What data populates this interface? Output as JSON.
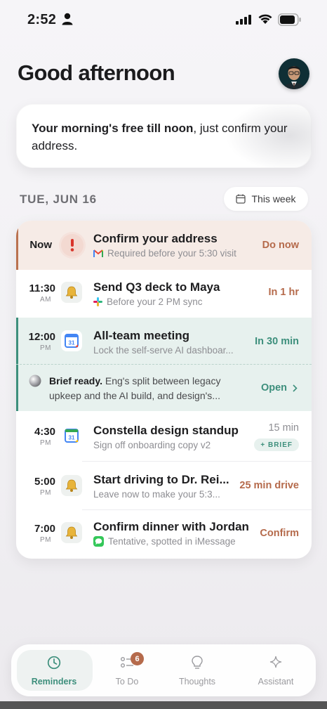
{
  "status_bar": {
    "time": "2:52"
  },
  "header": {
    "greeting": "Good afternoon"
  },
  "summary": {
    "bold": "Your morning's free till noon",
    "rest": ", just confirm your address."
  },
  "day": {
    "label": "TUE, JUN 16",
    "week_button": "This week"
  },
  "items": [
    {
      "time": "Now",
      "ampm": "",
      "title": "Confirm your address",
      "sub": "Required before your 5:30 visit",
      "action": "Do now",
      "icon": "exclamation-icon",
      "sub_icon": "gmail-icon"
    },
    {
      "time": "11:30",
      "ampm": "AM",
      "title": "Send Q3 deck to Maya",
      "sub": "Before your 2 PM sync",
      "action": "In 1 hr",
      "icon": "bell-icon",
      "sub_icon": "slack-icon"
    },
    {
      "time": "12:00",
      "ampm": "PM",
      "title": "All-team meeting",
      "sub": "Lock the self-serve AI dashboar...",
      "action": "In 30 min",
      "icon": "google-calendar-icon"
    },
    {
      "time": "4:30",
      "ampm": "PM",
      "title": "Constella design standup",
      "sub": "Sign off onboarding copy v2",
      "action": "15 min",
      "tag": "+ BRIEF",
      "icon": "google-calendar-icon"
    },
    {
      "time": "5:00",
      "ampm": "PM",
      "title": "Start driving to Dr. Rei...",
      "sub": "Leave now to make your 5:3...",
      "action": "25 min drive",
      "icon": "bell-icon"
    },
    {
      "time": "7:00",
      "ampm": "PM",
      "title": "Confirm dinner with Jordan",
      "sub": "Tentative, spotted in iMessage",
      "action": "Confirm",
      "icon": "bell-icon",
      "sub_icon": "imessage-icon"
    }
  ],
  "brief": {
    "bold": "Brief ready.",
    "line1": " Eng's split between legacy",
    "line2": "upkeep and the AI build, and design's...",
    "action": "Open"
  },
  "calendar_day": "31",
  "tabs": [
    {
      "label": "Reminders",
      "icon": "clock-icon",
      "active": true
    },
    {
      "label": "To Do",
      "icon": "checklist-icon",
      "badge": "6"
    },
    {
      "label": "Thoughts",
      "icon": "lightbulb-icon"
    },
    {
      "label": "Assistant",
      "icon": "sparkle-icon"
    }
  ],
  "colors": {
    "accent_teal": "#3d8f7c",
    "accent_rust": "#b56a4b",
    "now_bg": "#f6ebe6",
    "meeting_bg": "#e7f1ee"
  }
}
